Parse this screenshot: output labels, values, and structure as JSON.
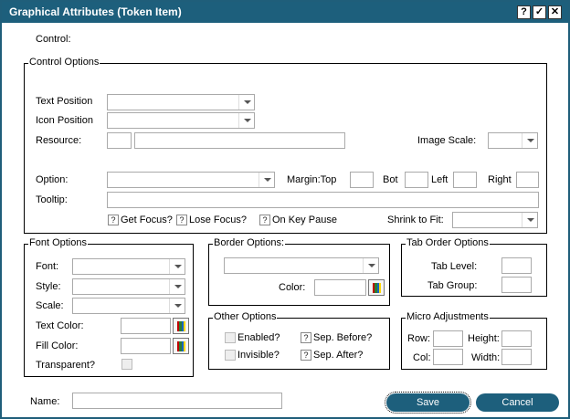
{
  "window": {
    "title": "Graphical Attributes (Token Item)",
    "btn_help": "?",
    "btn_ok": "✓",
    "btn_close": "✕"
  },
  "control_label": "Control:",
  "control_options": {
    "title": "Control Options",
    "text_position": "Text Position",
    "icon_position": "Icon Position",
    "resource": "Resource:",
    "image_scale": "Image Scale:",
    "option": "Option:",
    "margin_top": "Margin:Top",
    "bot": "Bot",
    "left": "Left",
    "right": "Right",
    "tooltip": "Tooltip:",
    "get_focus": "Get Focus?",
    "lose_focus": "Lose Focus?",
    "on_key_pause": "On Key Pause",
    "shrink_to_fit": "Shrink to Fit:",
    "check_mark": "?"
  },
  "font_options": {
    "title": "Font Options",
    "font": "Font:",
    "style": "Style:",
    "scale": "Scale:",
    "text_color": "Text Color:",
    "fill_color": "Fill Color:",
    "transparent": "Transparent?"
  },
  "border_options": {
    "title": "Border Options:",
    "color": "Color:"
  },
  "other_options": {
    "title": "Other Options",
    "enabled": "Enabled?",
    "invisible": "Invisible?",
    "sep_before": "Sep. Before?",
    "sep_after": "Sep. After?",
    "check_mark": "?"
  },
  "tab_order": {
    "title": "Tab Order Options",
    "tab_level": "Tab Level:",
    "tab_group": "Tab Group:"
  },
  "micro": {
    "title": "Micro Adjustments",
    "row": "Row:",
    "height": "Height:",
    "col": "Col:",
    "width": "Width:"
  },
  "name_label": "Name:",
  "buttons": {
    "save": "Save",
    "cancel": "Cancel"
  },
  "colors": {
    "accent": "#1d5f7c",
    "swatch": [
      "#c00000",
      "#2e7d32",
      "#1565c0",
      "#ffd600"
    ]
  }
}
